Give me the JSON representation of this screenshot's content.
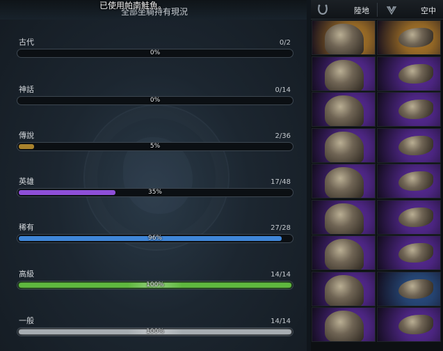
{
  "notice": "已使用帕南鮭魚。",
  "title": "全部坐騎持有現況",
  "categories": [
    {
      "name": "古代",
      "count": "0/2",
      "percent_label": "0%",
      "fill": 0,
      "color": "#b8862b"
    },
    {
      "name": "神話",
      "count": "0/14",
      "percent_label": "0%",
      "fill": 0,
      "color": "#b8862b"
    },
    {
      "name": "傳說",
      "count": "2/36",
      "percent_label": "5%",
      "fill": 0.0556,
      "color": "#a9822c"
    },
    {
      "name": "英雄",
      "count": "17/48",
      "percent_label": "35%",
      "fill": 0.354,
      "color": "#8e4fd8"
    },
    {
      "name": "稀有",
      "count": "27/28",
      "percent_label": "96%",
      "fill": 0.964,
      "color": "#3f86d8"
    },
    {
      "name": "高級",
      "count": "14/14",
      "percent_label": "100%",
      "fill": 1,
      "color": "#5fb83e"
    },
    {
      "name": "一般",
      "count": "14/14",
      "percent_label": "100%",
      "fill": 1,
      "color": "#a7adb2"
    }
  ],
  "tabs": [
    {
      "label": "陸地",
      "icon": "horseshoe-icon"
    },
    {
      "label": "空中",
      "icon": "wings-icon"
    }
  ],
  "mount_grid": {
    "rows": [
      [
        "ancient",
        "ancient"
      ],
      [
        "heroic",
        "heroic"
      ],
      [
        "heroic",
        "heroic"
      ],
      [
        "heroic",
        "heroic"
      ],
      [
        "heroic",
        "heroic"
      ],
      [
        "heroic",
        "heroic"
      ],
      [
        "heroic",
        "heroic"
      ],
      [
        "heroic",
        "rare"
      ],
      [
        "heroic",
        "heroic"
      ]
    ],
    "rarity_colors": {
      "ancient": "#b07a2a",
      "heroic": "#5a2a9a",
      "rare": "#2a4f86"
    }
  }
}
